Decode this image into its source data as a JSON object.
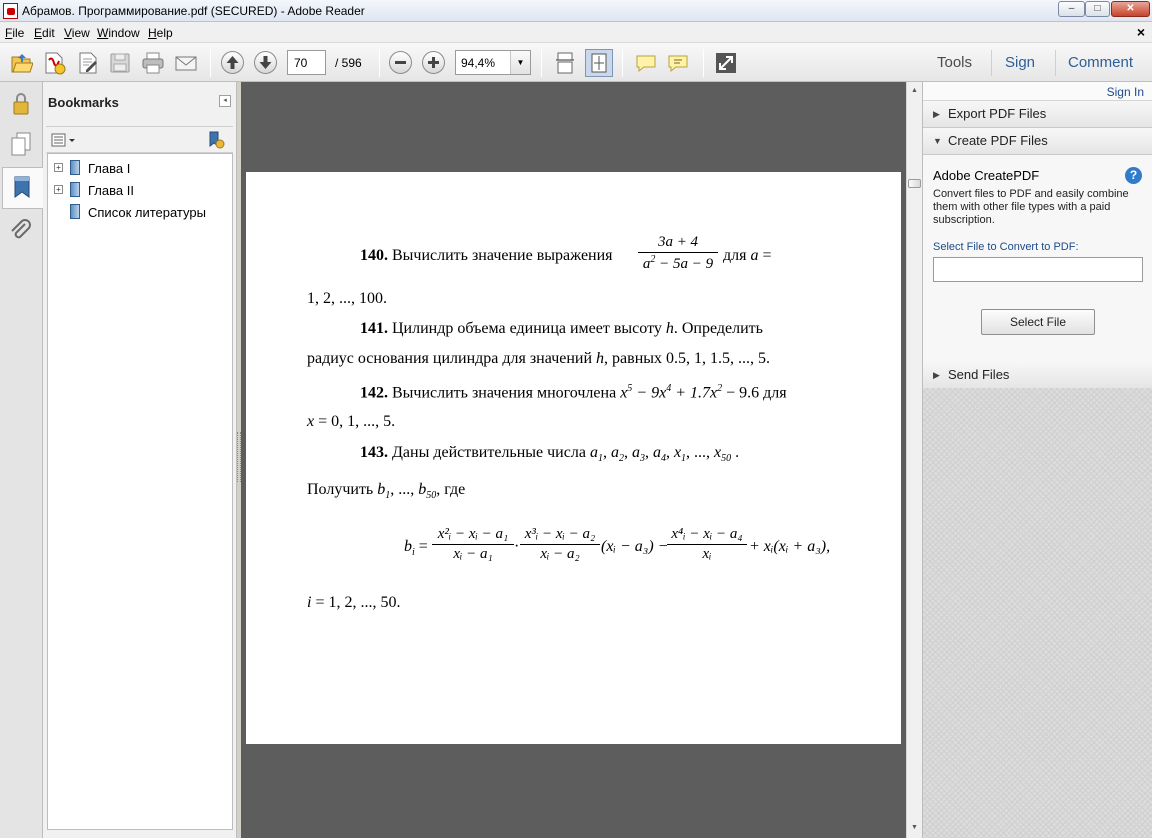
{
  "window": {
    "title": "Абрамов. Программирование.pdf (SECURED) - Adobe Reader",
    "buttons": {
      "minimize": "–",
      "maximize": "□",
      "close": "✕"
    }
  },
  "menu": {
    "items": [
      {
        "u": "F",
        "rest": "ile"
      },
      {
        "u": "E",
        "rest": "dit"
      },
      {
        "u": "V",
        "rest": "iew"
      },
      {
        "u": "W",
        "rest": "indow"
      },
      {
        "u": "H",
        "rest": "elp"
      }
    ],
    "close": "×"
  },
  "toolbar": {
    "page_current": "70",
    "page_total": "/   596",
    "zoom": "94,4%",
    "zoom_arrow": "▼",
    "tabs": [
      "Tools",
      "Sign",
      "Comment"
    ]
  },
  "bookmarks": {
    "title": "Bookmarks",
    "collapse": "◂",
    "expander": "+",
    "items": [
      "Глава I",
      "Глава II",
      "Список литературы"
    ]
  },
  "scroll": {
    "up": "▲",
    "down": "▼"
  },
  "document": {
    "p140": {
      "num": "140.",
      "text": " Вычислить значение выражения",
      "frac_num": "3a + 4",
      "frac_den_a": "a",
      "frac_den_exp": "2",
      "frac_den_rest": " − 5a − 9",
      "after": "для",
      "var": "a",
      "eq": " =",
      "line2": "1, 2, ..., 100."
    },
    "p141": {
      "num": "141.",
      "text": " Цилиндр объема единица имеет высоту ",
      "var": "h",
      "text2": ". Определить",
      "line2a": "радиус основания цилиндра для значений ",
      "line2var": "h",
      "line2b": ", равных 0.5, 1, 1.5, ..., 5."
    },
    "p142": {
      "num": "142.",
      "text": " Вычислить значения многочлена ",
      "poly1": "x",
      "exp5": "5",
      "poly2": " − 9x",
      "exp4": "4",
      "poly3": " + 1.7x",
      "exp2": "2",
      "poly4": " − 9.6",
      "after": " для",
      "line2var": "x",
      "line2": " = 0, 1, ..., 5."
    },
    "p143": {
      "num": "143.",
      "text": " Даны действительные числа ",
      "a": "a",
      "s1": "1",
      "s2": "2",
      "s3": "3",
      "s4": "4",
      "x": "x",
      "x1": "1",
      "dots": ", ..., ",
      "s50": "50",
      "comma": ", ",
      "end": " ."
    },
    "p143b": {
      "text": "Получить ",
      "b": "b",
      "s1": "1",
      "dots": ", ..., ",
      "s50": "50",
      "after": ", где"
    },
    "formula": {
      "lhs": "b",
      "lhs_sub": "i",
      "eq": " =",
      "f1_num": "x²ᵢ − xᵢ − a₁",
      "f1_den": "xᵢ − a₁",
      "dot": "·",
      "f2_num": "x³ᵢ − xᵢ − a₂",
      "f2_den": "xᵢ − a₂",
      "mid": "(xᵢ − a₃) −",
      "f3_num": "x⁴ᵢ − xᵢ − a₄",
      "f3_den": "xᵢ",
      "tail": "+ xᵢ(xᵢ + a₃),"
    },
    "p143c": {
      "var": "i",
      "text": " = 1, 2, ..., 50."
    }
  },
  "right_pane": {
    "signin": "Sign In",
    "sections": [
      {
        "arrow": "▶",
        "label": "Export PDF Files"
      },
      {
        "arrow": "▼",
        "label": "Create PDF Files"
      },
      {
        "arrow": "▶",
        "label": "Send Files"
      }
    ],
    "createpdf": {
      "title": "Adobe CreatePDF",
      "help": "?",
      "description": "Convert files to PDF and easily combine them with other file types with a paid subscription.",
      "label": "Select File to Convert to PDF:",
      "button": "Select File"
    }
  }
}
